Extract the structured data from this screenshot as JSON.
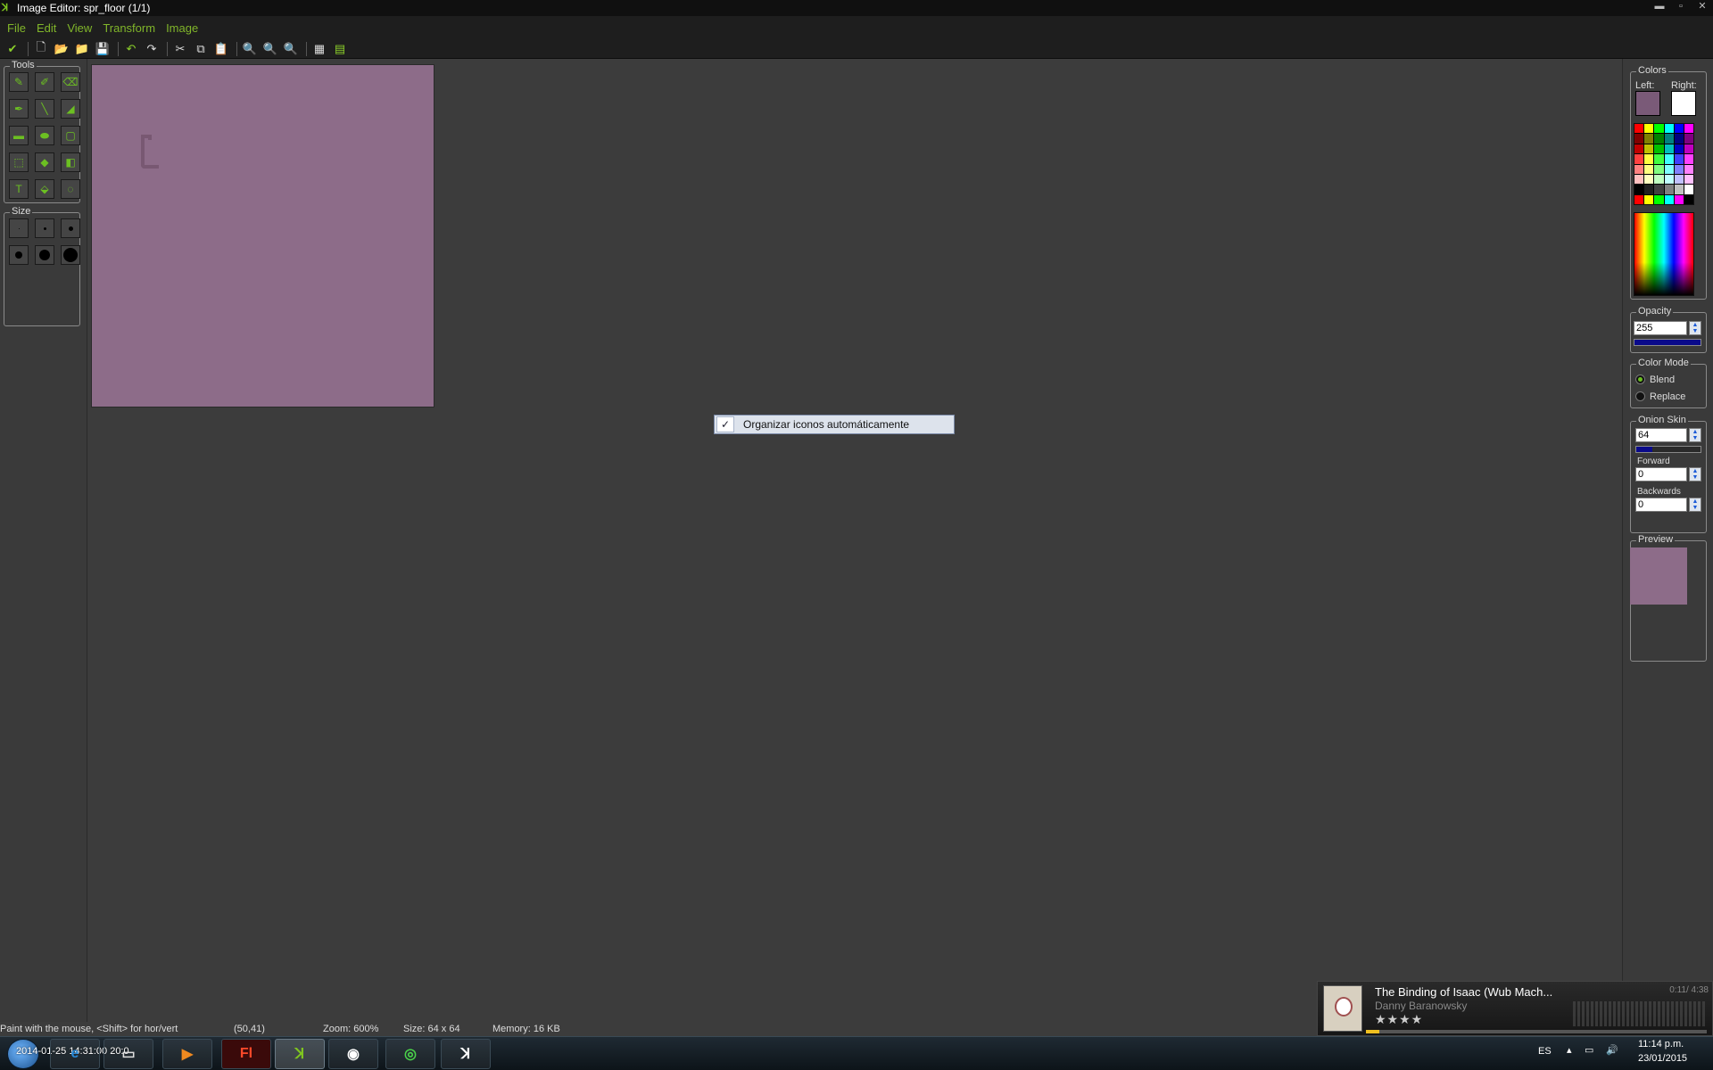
{
  "window": {
    "title": "Image Editor: spr_floor (1/1)",
    "minimize": "▬",
    "maximize": "▫",
    "close": "✕"
  },
  "menu": {
    "file": "File",
    "edit": "Edit",
    "view": "View",
    "transform": "Transform",
    "image": "Image"
  },
  "tools_label": "Tools",
  "size_label": "Size",
  "colors": {
    "label": "Colors",
    "left_label": "Left:",
    "right_label": "Right:",
    "left_color": "#7a5a78",
    "right_color": "#ffffff",
    "palette": [
      "#ff0000",
      "#ffff00",
      "#00ff00",
      "#00ffff",
      "#0000ff",
      "#ff00ff",
      "#800000",
      "#808000",
      "#008000",
      "#008080",
      "#000080",
      "#800080",
      "#c00000",
      "#c0c000",
      "#00c000",
      "#00c0c0",
      "#0000c0",
      "#c000c0",
      "#ff4040",
      "#ffff40",
      "#40ff40",
      "#40ffff",
      "#4040ff",
      "#ff40ff",
      "#ff8080",
      "#ffff80",
      "#80ff80",
      "#80ffff",
      "#8080ff",
      "#ff80ff",
      "#ffc0c0",
      "#ffffc0",
      "#c0ffc0",
      "#c0ffff",
      "#c0c0ff",
      "#ffc0ff",
      "#000000",
      "#202020",
      "#404040",
      "#808080",
      "#c0c0c0",
      "#ffffff",
      "#ff0000",
      "#ffff00",
      "#00ff00",
      "#00ffff",
      "#ff00ff",
      "#000000"
    ]
  },
  "opacity": {
    "label": "Opacity",
    "value": "255",
    "level": 1.0
  },
  "color_mode": {
    "label": "Color Mode",
    "blend": "Blend",
    "replace": "Replace"
  },
  "onion": {
    "label": "Onion Skin",
    "value": "64",
    "level": 0.25,
    "forward_label": "Forward",
    "forward": "0",
    "backwards_label": "Backwards",
    "backwards": "0"
  },
  "preview_label": "Preview",
  "context_menu": {
    "item": "Organizar iconos automáticamente",
    "check": "✓"
  },
  "status": {
    "hint": "Paint with the mouse, <Shift> for hor/vert",
    "pos": "(50,41)",
    "zoom": "Zoom: 600%",
    "size": "Size: 64 x 64",
    "memory": "Memory: 16 KB"
  },
  "media": {
    "title": "The Binding of Isaac (Wub Mach...",
    "artist": "Danny Baranowsky",
    "time": "0:11/ 4:38",
    "stars": "★★★★",
    "progress": 0.04
  },
  "taskbar": {
    "lang": "ES",
    "time": "11:14 p.m.",
    "date": "23/01/2015",
    "flash": "Fl",
    "overlay_text": "2014-01-25 14:31:00 20:0"
  }
}
